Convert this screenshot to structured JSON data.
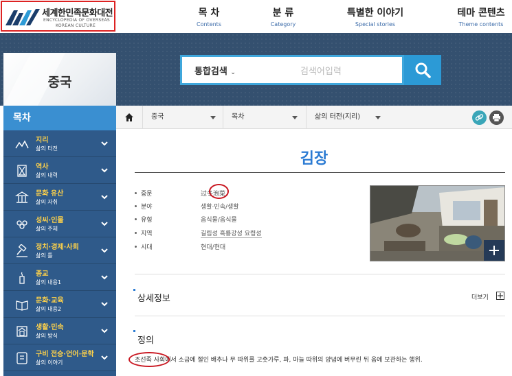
{
  "header": {
    "logo_title": "세계한민족문화대전",
    "logo_sub1": "ENCYCLOPEDIA OF OVERSEAS",
    "logo_sub2": "KOREAN CULTURE",
    "nav": [
      {
        "ko": "목 차",
        "en": "Contents"
      },
      {
        "ko": "분 류",
        "en": "Category"
      },
      {
        "ko": "특별한 이야기",
        "en": "Special stories"
      },
      {
        "ko": "테마 콘텐츠",
        "en": "Theme contents"
      }
    ]
  },
  "hero": {
    "region_title": "중국",
    "search_select": "통합검색",
    "search_placeholder": "검색어입력"
  },
  "sidebar": {
    "heading": "목차",
    "items": [
      {
        "label": "지리",
        "sub": "삶의 터전",
        "icon": "mountain-icon"
      },
      {
        "label": "역사",
        "sub": "삶의 내력",
        "icon": "hourglass-icon"
      },
      {
        "label": "문화 유산",
        "sub": "삶의 자취",
        "icon": "temple-icon"
      },
      {
        "label": "성씨·인물",
        "sub": "삶의 주체",
        "icon": "people-icon"
      },
      {
        "label": "정치·경제·사회",
        "sub": "삶의 틀",
        "icon": "gavel-icon"
      },
      {
        "label": "종교",
        "sub": "삶의 내용1",
        "icon": "candle-icon"
      },
      {
        "label": "문화·교육",
        "sub": "삶의 내용2",
        "icon": "book-icon"
      },
      {
        "label": "생활·민속",
        "sub": "삶의 방식",
        "icon": "house-icon"
      },
      {
        "label": "구비 전승·언어·문학",
        "sub": "삶의 이야기",
        "icon": "pen-icon"
      }
    ]
  },
  "breadcrumb": {
    "items": [
      "중국",
      "목차",
      "삶의 터전(지리)"
    ]
  },
  "article": {
    "title": "김장",
    "meta": [
      {
        "key": "중문",
        "value": "过冬泡菜"
      },
      {
        "key": "분야",
        "value": "생활·민속/생활"
      },
      {
        "key": "유형",
        "value": "음식물/음식물"
      },
      {
        "key": "지역",
        "value": "길림성 흑룡강성 요령성"
      },
      {
        "key": "시대",
        "value": "현대/현대"
      }
    ],
    "detail_heading": "상세정보",
    "more_label": "더보기",
    "definition_heading": "정의",
    "definition_text": "조선족 사회에서 소금에 절인 배추나 무 따위를 고춧가루, 파, 마늘 따위의 양념에 버무린 뒤 음에 보관하는 행위."
  },
  "colors": {
    "accent_blue": "#2b7bd3",
    "sidebar_bg": "#2f5a8a",
    "sidebar_label": "#ffd24a",
    "annotation_red": "#c8141e"
  }
}
